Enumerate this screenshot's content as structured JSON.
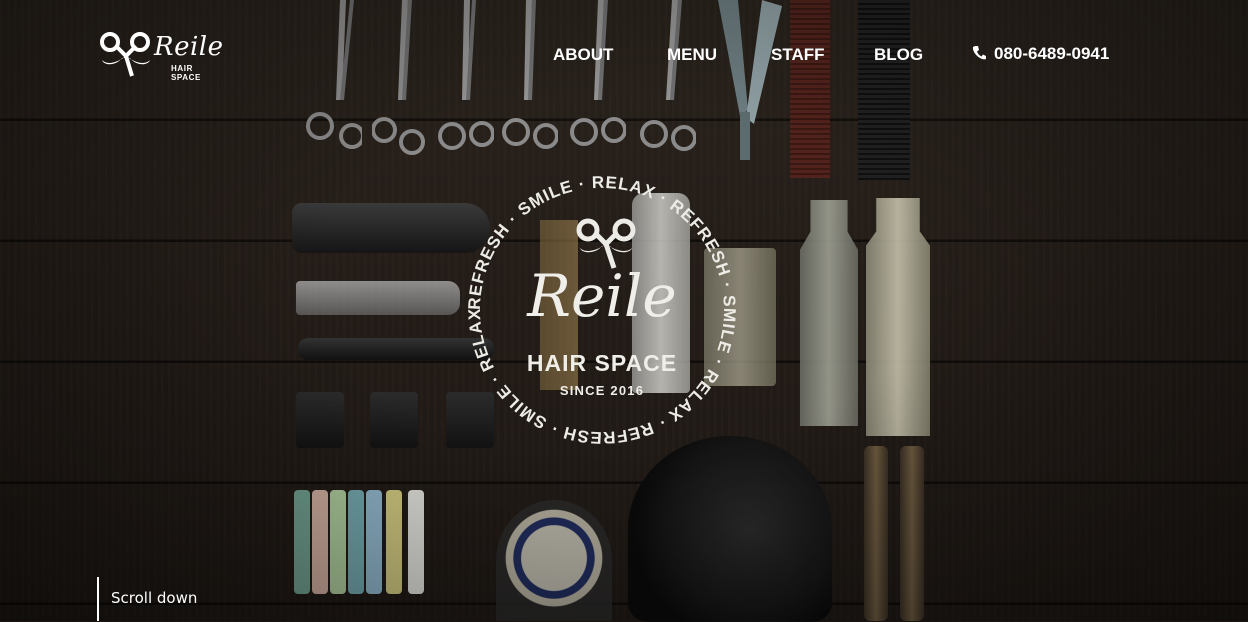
{
  "brand": {
    "logo_name": "Reile",
    "logo_sub": "HAIR SPACE"
  },
  "nav": {
    "items": [
      {
        "label": "ABOUT"
      },
      {
        "label": "MENU"
      },
      {
        "label": "STAFF"
      },
      {
        "label": "BLOG"
      }
    ],
    "phone_icon": "phone-icon",
    "phone": "080-6489-0941"
  },
  "emblem": {
    "title": "Reile",
    "subtitle": "HAIR SPACE",
    "since": "SINCE 2016",
    "ring_text": "REFRESH · SMILE · RELAX · REFRESH · SMILE · RELAX · REFRESH · SMILE · RELAX ·"
  },
  "scroll": {
    "label": "Scroll down"
  },
  "colors": {
    "text": "#ffffff",
    "background": "#231c17"
  }
}
